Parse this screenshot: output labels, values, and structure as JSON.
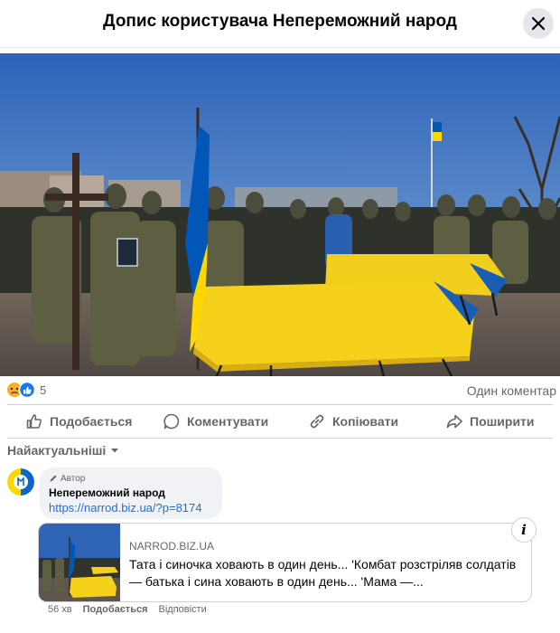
{
  "header": {
    "title": "Допис користувача Непереможний народ",
    "close_icon": "close-icon"
  },
  "post": {
    "photo_icon": "funeral-ceremony-photo"
  },
  "reactions": {
    "icons": [
      "sad-reaction-icon",
      "like-reaction-icon"
    ],
    "count": "5",
    "comments": "Один коментар"
  },
  "actions": {
    "like": "Подобається",
    "comment": "Коментувати",
    "copy": "Копіювати",
    "share": "Поширити"
  },
  "sort": {
    "label": "Найактуальніші"
  },
  "comment": {
    "badge": "Автор",
    "author": "Непереможний народ",
    "link": "https://narrod.biz.ua/?p=8174",
    "preview": {
      "domain": "NARROD.BIZ.UA",
      "title": "Тата і синочка ховають в один день... 'Комбат розстріляв солдатів — батька і сина ховають в один день... 'Мама —..."
    },
    "time": "56 хв",
    "like": "Подобається",
    "reply": "Відповісти"
  },
  "colors": {
    "accent_link": "#216fdb",
    "secondary_text": "#65676b",
    "flag_blue": "#0057b7",
    "flag_yellow": "#ffd700"
  }
}
